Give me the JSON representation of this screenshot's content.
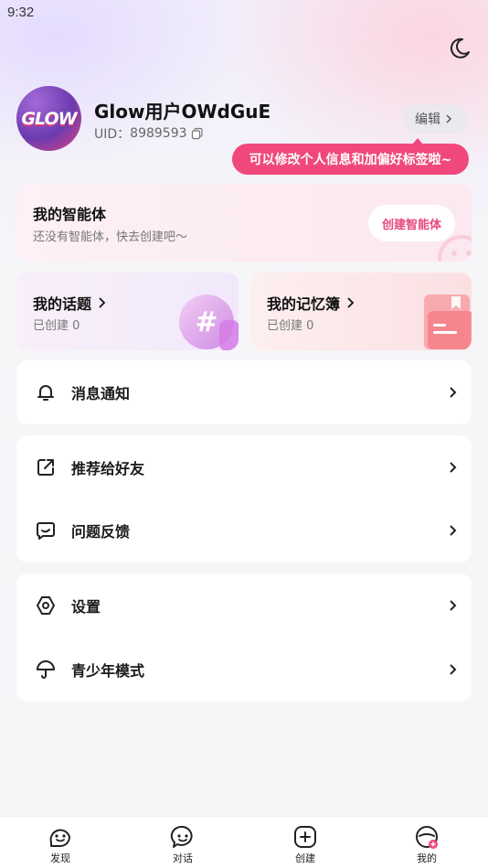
{
  "status_bar": {
    "time": "9:32"
  },
  "profile": {
    "avatar_text": "GLOW",
    "username": "Glow用户OWdGuE",
    "uid_label": "UID：",
    "uid_value": "8989593",
    "edit_label": "编辑",
    "tooltip": "可以修改个人信息和加偏好标签啦~"
  },
  "agent_card": {
    "title": "我的智能体",
    "subtitle": "还没有智能体，快去创建吧～",
    "button": "创建智能体"
  },
  "topic_card": {
    "title": "我的话题",
    "subtitle": "已创建 0"
  },
  "memo_card": {
    "title": "我的记忆簿",
    "subtitle": "已创建 0"
  },
  "menu": {
    "notifications": "消息通知",
    "recommend": "推荐给好友",
    "feedback": "问题反馈",
    "settings": "设置",
    "youth_mode": "青少年模式"
  },
  "tabbar": {
    "discover": "发现",
    "chat": "对话",
    "create": "创建",
    "mine": "我的"
  },
  "colors": {
    "accent_pink": "#f0487c",
    "agent_button_text": "#e64a7e"
  }
}
